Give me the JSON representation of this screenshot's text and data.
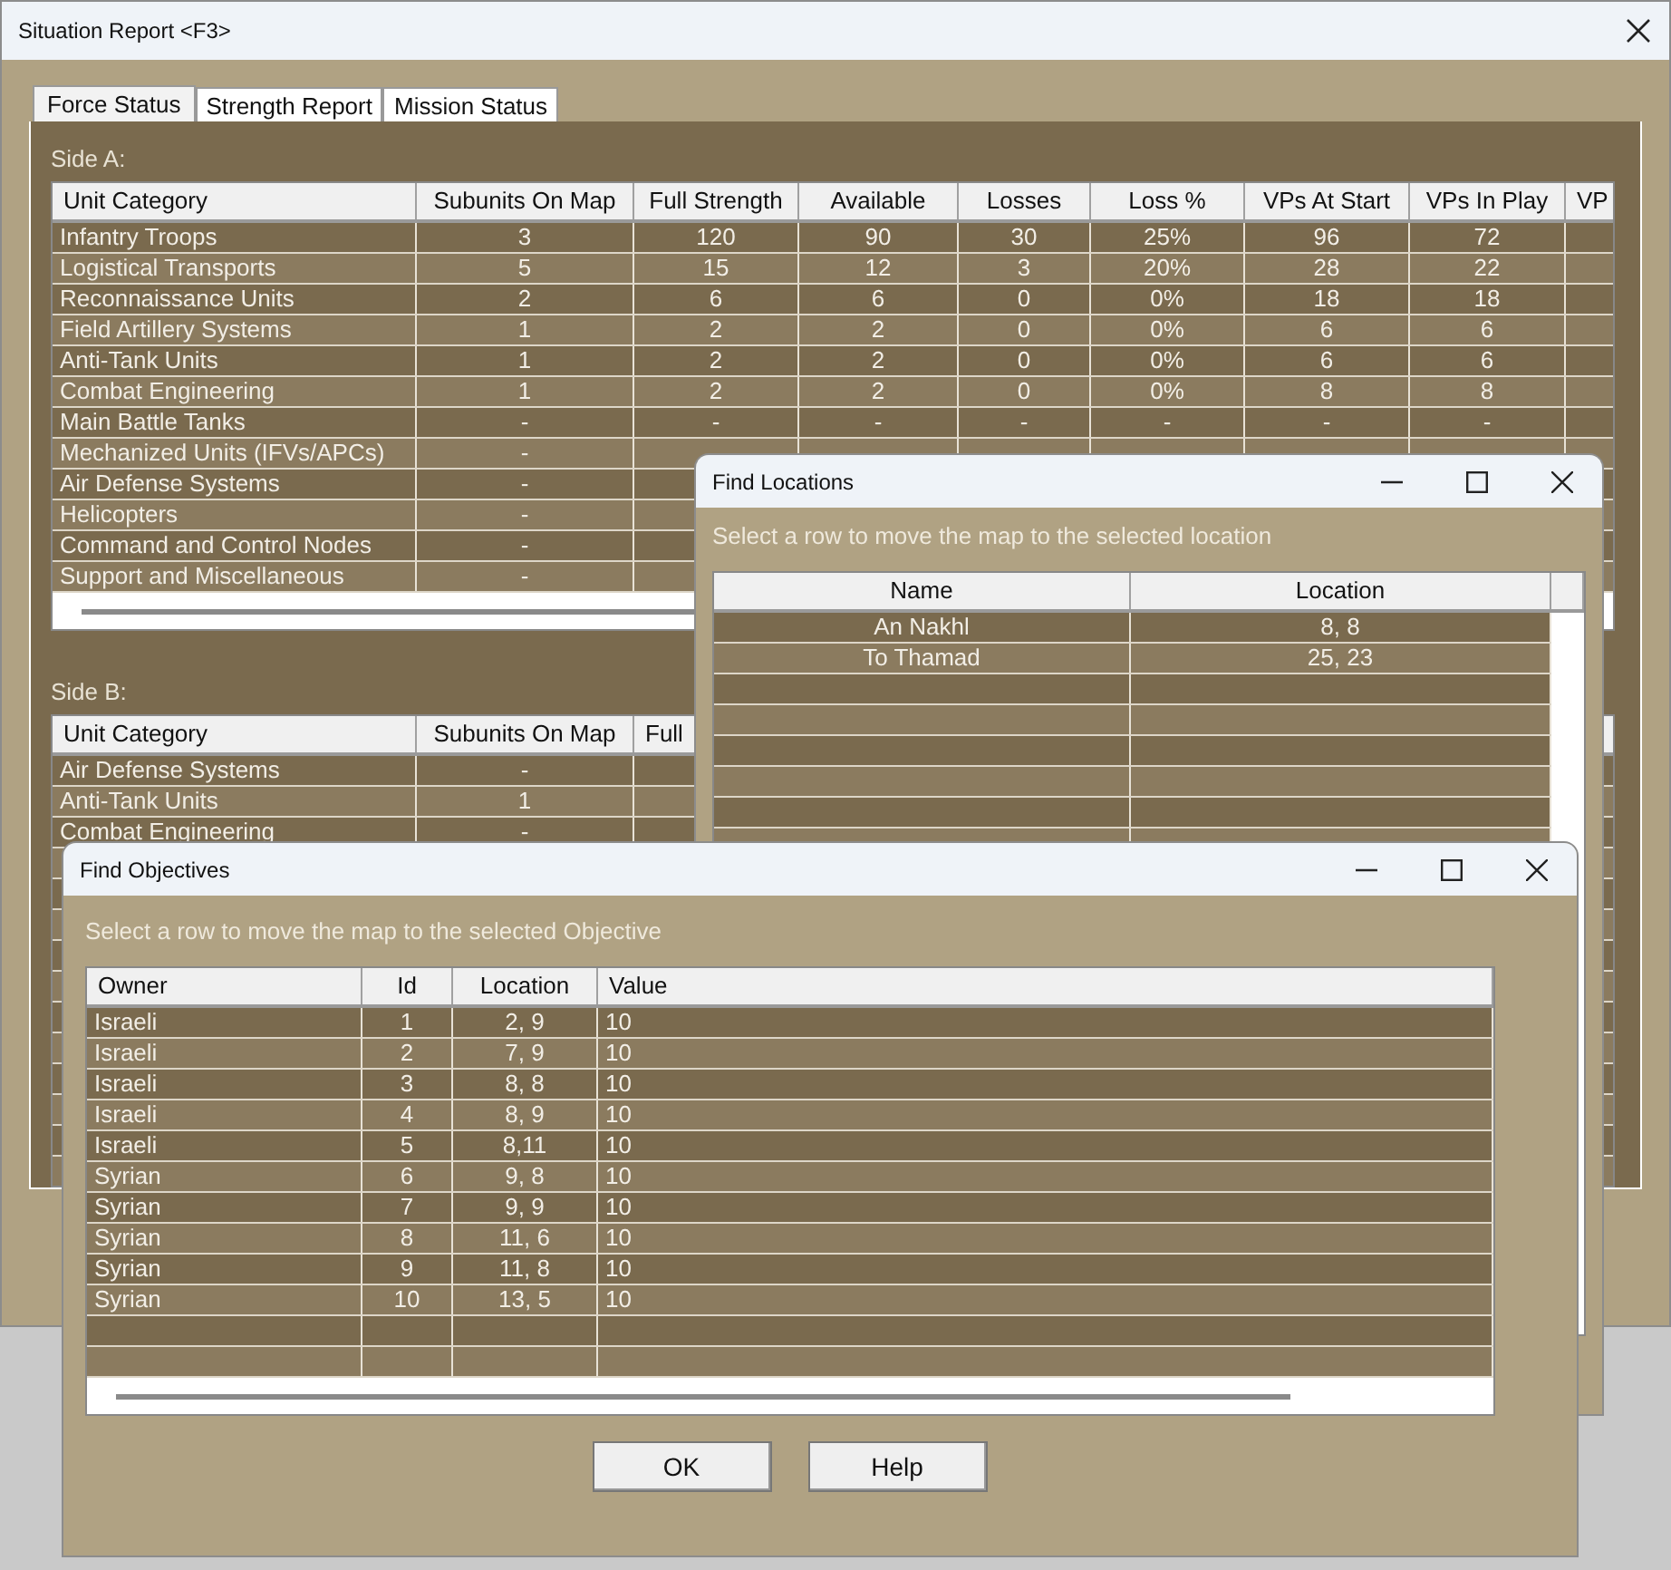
{
  "main_window": {
    "title": "Situation Report <F3>",
    "tabs": [
      {
        "label": "Force Status",
        "selected": true
      },
      {
        "label": "Strength Report",
        "selected": false
      },
      {
        "label": "Mission Status",
        "selected": false
      }
    ],
    "side_a": {
      "label": "Side A:",
      "columns": [
        "Unit Category",
        "Subunits On Map",
        "Full Strength",
        "Available",
        "Losses",
        "Loss %",
        "VPs At Start",
        "VPs In Play",
        "VP"
      ],
      "rows": [
        {
          "cells": [
            "Infantry Troops",
            "3",
            "120",
            "90",
            "30",
            "25%",
            "96",
            "72"
          ]
        },
        {
          "cells": [
            "Logistical Transports",
            "5",
            "15",
            "12",
            "3",
            "20%",
            "28",
            "22"
          ]
        },
        {
          "cells": [
            "Reconnaissance Units",
            "2",
            "6",
            "6",
            "0",
            "0%",
            "18",
            "18"
          ]
        },
        {
          "cells": [
            "Field Artillery Systems",
            "1",
            "2",
            "2",
            "0",
            "0%",
            "6",
            "6"
          ]
        },
        {
          "cells": [
            "Anti-Tank Units",
            "1",
            "2",
            "2",
            "0",
            "0%",
            "6",
            "6"
          ]
        },
        {
          "cells": [
            "Combat Engineering",
            "1",
            "2",
            "2",
            "0",
            "0%",
            "8",
            "8"
          ]
        },
        {
          "cells": [
            "Main Battle Tanks",
            "-",
            "-",
            "-",
            "-",
            "-",
            "-",
            "-"
          ]
        },
        {
          "cells": [
            "Mechanized Units (IFVs/APCs)",
            "-"
          ]
        },
        {
          "cells": [
            "Air Defense Systems",
            "-"
          ]
        },
        {
          "cells": [
            "Helicopters",
            "-"
          ]
        },
        {
          "cells": [
            "Command and Control Nodes",
            "-"
          ]
        },
        {
          "cells": [
            "Support and Miscellaneous",
            "-"
          ]
        }
      ]
    },
    "side_b": {
      "label": "Side B:",
      "columns": [
        "Unit Category",
        "Subunits On Map",
        "Full"
      ],
      "rows": [
        {
          "cells": [
            "Air Defense Systems",
            "-"
          ]
        },
        {
          "cells": [
            "Anti-Tank Units",
            "1"
          ]
        },
        {
          "cells": [
            "Combat Engineering",
            "-"
          ]
        }
      ]
    }
  },
  "find_locations": {
    "title": "Find Locations",
    "hint": "Select a row to move the map to the selected location",
    "columns": [
      "Name",
      "Location"
    ],
    "rows": [
      {
        "cells": [
          "An Nakhl",
          "8, 8"
        ]
      },
      {
        "cells": [
          "To Thamad",
          "25, 23"
        ]
      }
    ]
  },
  "find_objectives": {
    "title": "Find Objectives",
    "hint": "Select a row to move the map to the selected Objective",
    "columns": [
      "Owner",
      "Id",
      "Location",
      "Value"
    ],
    "rows": [
      {
        "cells": [
          "Israeli",
          "1",
          "2, 9",
          "10"
        ]
      },
      {
        "cells": [
          "Israeli",
          "2",
          "7, 9",
          "10"
        ]
      },
      {
        "cells": [
          "Israeli",
          "3",
          "8, 8",
          "10"
        ]
      },
      {
        "cells": [
          "Israeli",
          "4",
          "8, 9",
          "10"
        ]
      },
      {
        "cells": [
          "Israeli",
          "5",
          "8,11",
          "10"
        ]
      },
      {
        "cells": [
          "Syrian",
          "6",
          "9, 8",
          "10"
        ]
      },
      {
        "cells": [
          "Syrian",
          "7",
          "9, 9",
          "10"
        ]
      },
      {
        "cells": [
          "Syrian",
          "8",
          "11, 6",
          "10"
        ]
      },
      {
        "cells": [
          "Syrian",
          "9",
          "11, 8",
          "10"
        ]
      },
      {
        "cells": [
          "Syrian",
          "10",
          "13, 5",
          "10"
        ]
      }
    ],
    "buttons": [
      "OK",
      "Help"
    ]
  }
}
